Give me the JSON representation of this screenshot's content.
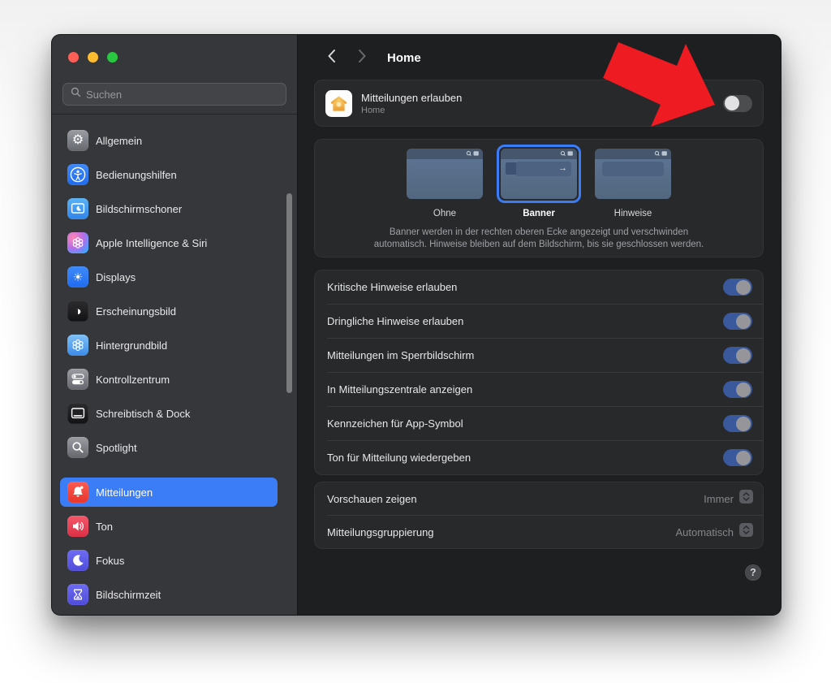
{
  "colors": {
    "accent": "#3b7cf7",
    "arrow": "#ee1b22",
    "traffic": [
      "#ff5f57",
      "#febc2e",
      "#28c840"
    ],
    "toggle_on_track": "#3a599c",
    "toggle_off_track": "#4c4d4f"
  },
  "sidebar": {
    "search": {
      "placeholder": "Suchen"
    },
    "items": [
      {
        "label": "Allgemein",
        "icon": "gear",
        "selected": false,
        "group_start": false
      },
      {
        "label": "Bedienungshilfen",
        "icon": "accessibility",
        "selected": false,
        "group_start": false
      },
      {
        "label": "Bildschirmschoner",
        "icon": "screensaver",
        "selected": false,
        "group_start": false
      },
      {
        "label": "Apple Intelligence & Siri",
        "icon": "siri",
        "selected": false,
        "group_start": false
      },
      {
        "label": "Displays",
        "icon": "displays",
        "selected": false,
        "group_start": false
      },
      {
        "label": "Erscheinungsbild",
        "icon": "appearance",
        "selected": false,
        "group_start": false
      },
      {
        "label": "Hintergrundbild",
        "icon": "wallpaper",
        "selected": false,
        "group_start": false
      },
      {
        "label": "Kontrollzentrum",
        "icon": "control-center",
        "selected": false,
        "group_start": false
      },
      {
        "label": "Schreibtisch & Dock",
        "icon": "desktop-dock",
        "selected": false,
        "group_start": false
      },
      {
        "label": "Spotlight",
        "icon": "spotlight",
        "selected": false,
        "group_start": false
      },
      {
        "label": "Mitteilungen",
        "icon": "notifications",
        "selected": true,
        "group_start": true
      },
      {
        "label": "Ton",
        "icon": "sound",
        "selected": false,
        "group_start": false
      },
      {
        "label": "Fokus",
        "icon": "focus",
        "selected": false,
        "group_start": false
      },
      {
        "label": "Bildschirmzeit",
        "icon": "screen-time",
        "selected": false,
        "group_start": false
      }
    ]
  },
  "header": {
    "title": "Home"
  },
  "allow_card": {
    "title": "Mitteilungen erlauben",
    "subtitle": "Home",
    "toggle_on": false
  },
  "style_card": {
    "options": [
      {
        "label": "Ohne",
        "preview": "none",
        "selected": false
      },
      {
        "label": "Banner",
        "preview": "banner",
        "selected": true
      },
      {
        "label": "Hinweise",
        "preview": "alert",
        "selected": false
      }
    ],
    "description": [
      "Banner werden in der rechten oberen Ecke angezeigt und verschwinden",
      "automatisch. Hinweise bleiben auf dem Bildschirm, bis sie geschlossen werden."
    ]
  },
  "settings_card": {
    "rows": [
      {
        "label": "Kritische Hinweise erlauben",
        "on": true
      },
      {
        "label": "Dringliche Hinweise erlauben",
        "on": true
      },
      {
        "label": "Mitteilungen im Sperrbildschirm",
        "on": true
      },
      {
        "label": "In Mitteilungszentrale anzeigen",
        "on": true
      },
      {
        "label": "Kennzeichen für App-Symbol",
        "on": true
      },
      {
        "label": "Ton für Mitteilung wiedergeben",
        "on": true
      }
    ]
  },
  "dropdown_card": {
    "rows": [
      {
        "label": "Vorschauen zeigen",
        "value": "Immer"
      },
      {
        "label": "Mitteilungsgruppierung",
        "value": "Automatisch"
      }
    ]
  },
  "help": {
    "label": "?"
  }
}
